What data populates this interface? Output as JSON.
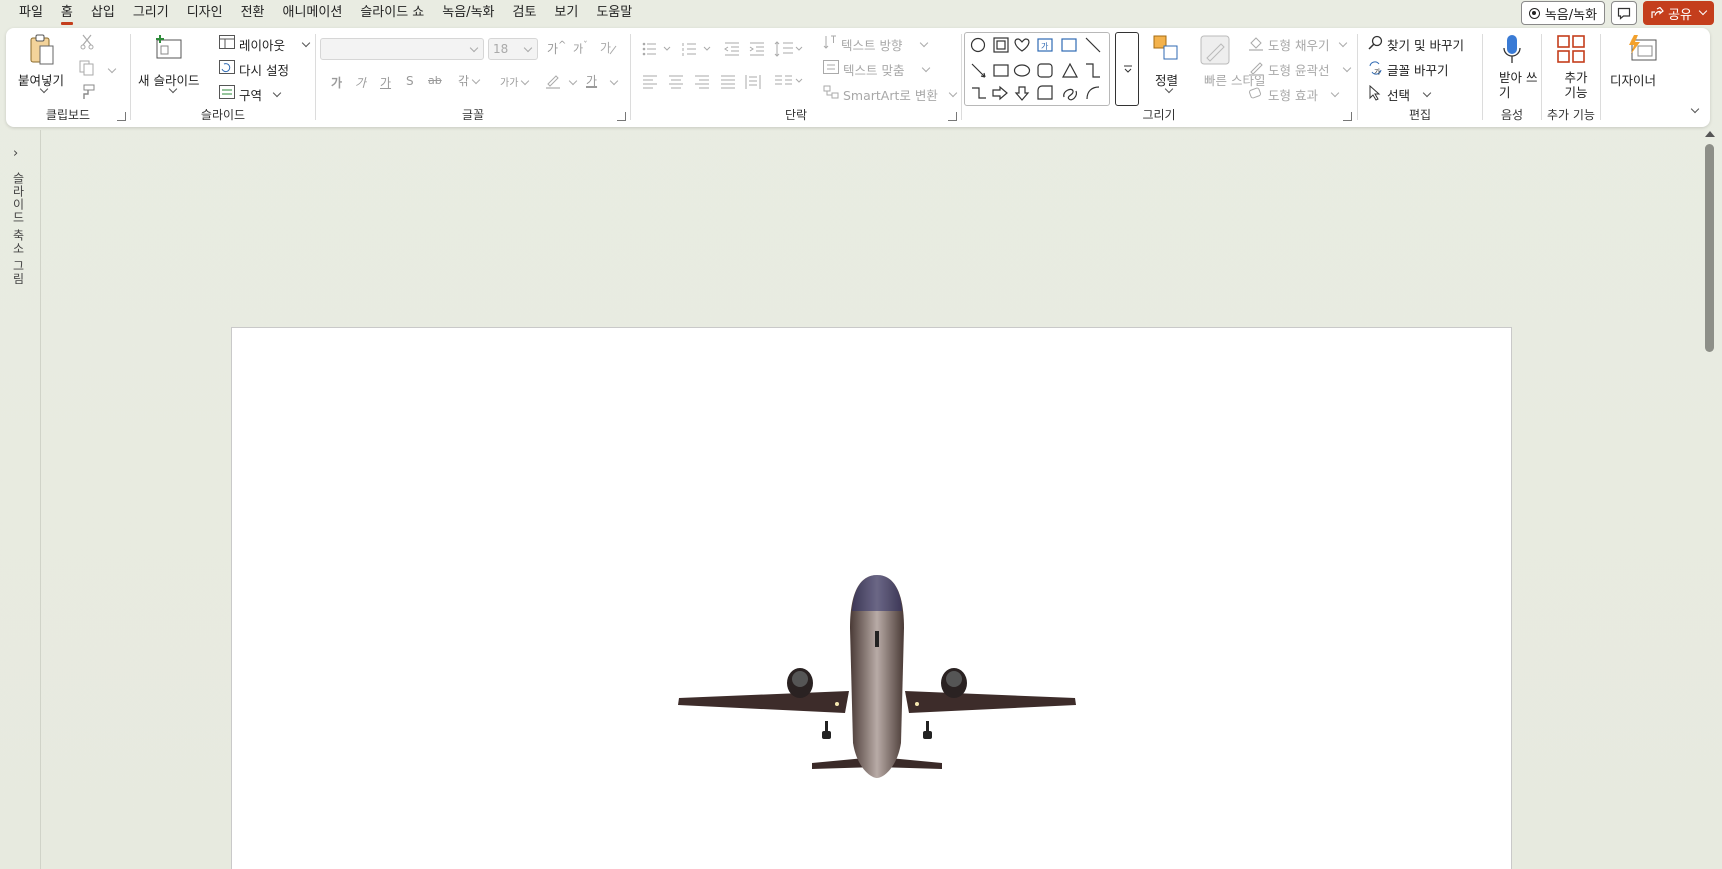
{
  "menu": {
    "tabs": [
      "파일",
      "홈",
      "삽입",
      "그리기",
      "디자인",
      "전환",
      "애니메이션",
      "슬라이드 쇼",
      "녹음/녹화",
      "검토",
      "보기",
      "도움말"
    ],
    "active_tab": "홈",
    "record_label": "녹음/녹화",
    "share_label": "공유"
  },
  "ribbon": {
    "clipboard": {
      "label": "클립보드",
      "paste": "붙여넣기"
    },
    "slides": {
      "label": "슬라이드",
      "new_slide": "새 슬라이드",
      "layout": "레이아웃",
      "reset": "다시 설정",
      "section": "구역"
    },
    "font": {
      "label": "글꼴",
      "font_name": "",
      "font_size": "18",
      "bold": "가",
      "italic": "가",
      "underline": "가",
      "shadow": "S",
      "strike": "ab",
      "spacing": "갂",
      "case": "가가",
      "color": "가"
    },
    "paragraph": {
      "label": "단락",
      "text_direction": "텍스트 방향",
      "align_text": "텍스트 맞춤",
      "smartart": "SmartArt로 변환"
    },
    "drawing": {
      "label": "그리기",
      "arrange": "정렬",
      "quick_styles": "빠른 스타일",
      "fill": "도형 채우기",
      "outline": "도형 윤곽선",
      "effects": "도형 효과"
    },
    "editing": {
      "label": "편집",
      "find": "찾기 및 바꾸기",
      "replace_fonts": "글꼴 바꾸기",
      "select": "선택"
    },
    "voice": {
      "label": "음성",
      "dictate": "받아 쓰기"
    },
    "addins": {
      "label": "추가 기능",
      "addins_btn": "추가 기능"
    },
    "designer": {
      "label": "디자이너"
    }
  },
  "left_pane": {
    "label": "슬라이드 축소 그림"
  },
  "colors": {
    "accent": "#c43e1c",
    "ribbon_bg": "#ffffff",
    "app_bg": "#e9ece2"
  }
}
